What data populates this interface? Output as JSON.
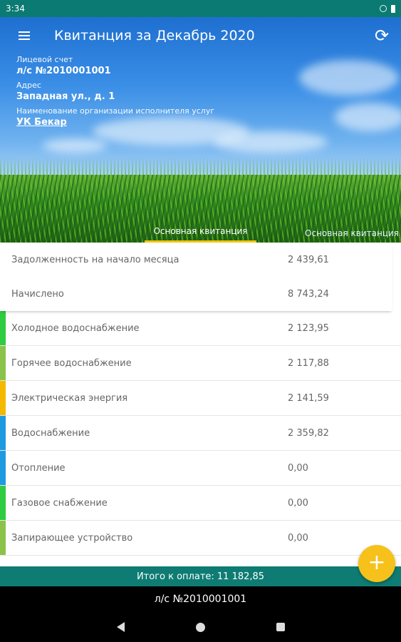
{
  "status_bar": {
    "time": "3:34"
  },
  "toolbar": {
    "title": "Квитанция за Декабрь 2020"
  },
  "info": {
    "account_label": "Лицевой счет",
    "account_value": "л/с №2010001001",
    "address_label": "Адрес",
    "address_value": "Западная ул., д. 1",
    "org_label": "Наименование организации исполнителя услуг",
    "org_value": "УК Бекар"
  },
  "tabs": [
    {
      "label": "Основная квитанция",
      "active": true
    },
    {
      "label": "Основная квитанция",
      "active": false
    }
  ],
  "summary": [
    {
      "name": "Задолженность на начало месяца",
      "value": "2 439,61"
    },
    {
      "name": "Начислено",
      "value": "8 743,24"
    }
  ],
  "services": [
    {
      "name": "Холодное водоснабжение",
      "value": "2 123,95",
      "color": "#2ecc40"
    },
    {
      "name": "Горячее водоснабжение",
      "value": "2 117,88",
      "color": "#8bc34a"
    },
    {
      "name": "Электрическая энергия",
      "value": "2 141,59",
      "color": "#f5b800"
    },
    {
      "name": "Водоснабжение",
      "value": "2 359,82",
      "color": "#1e9be0"
    },
    {
      "name": "Отопление",
      "value": "0,00",
      "color": "#1e9be0"
    },
    {
      "name": "Газовое снабжение",
      "value": "0,00",
      "color": "#2ecc40"
    },
    {
      "name": "Запирающее устройство",
      "value": "0,00",
      "color": "#8bc34a"
    }
  ],
  "total": {
    "label": "Итого к оплате: 11 182,85"
  },
  "account_bar": {
    "label": "л/с №2010001001"
  },
  "fab": {
    "symbol": "+"
  }
}
